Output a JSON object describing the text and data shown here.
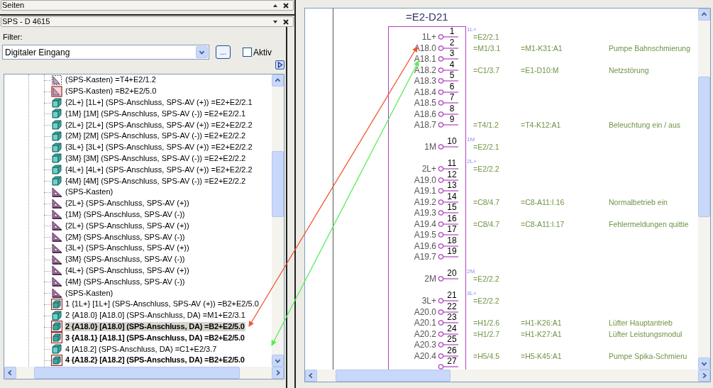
{
  "pages_panel": {
    "title": "Seiten"
  },
  "plc_panel": {
    "title": "SPS - D 4615",
    "filter_label": "Filter:",
    "filter": {
      "value": "Digitaler Eingang"
    },
    "browse_button": "...",
    "active_checkbox": {
      "label": "Aktiv",
      "checked": false
    },
    "tree": {
      "items": [
        {
          "kind": "box_dashed",
          "label": "(SPS-Kasten) =T4+E2/1.2",
          "bold": false,
          "selected": false
        },
        {
          "kind": "box_framed",
          "label": "(SPS-Kasten) =B2+E2/5.0",
          "bold": false,
          "selected": false
        },
        {
          "kind": "cube",
          "label": "{2L+} [1L+] (SPS-Anschluss, SPS-AV (+)) =E2+E2/2.1",
          "bold": false,
          "selected": false
        },
        {
          "kind": "cube",
          "label": "{1M} [1M] (SPS-Anschluss, SPS-AV (-)) =E2+E2/2.1",
          "bold": false,
          "selected": false
        },
        {
          "kind": "cube",
          "label": "{2L+} [2L+] (SPS-Anschluss, SPS-AV (+)) =E2+E2/2.2",
          "bold": false,
          "selected": false
        },
        {
          "kind": "cube",
          "label": "{2M} [2M] (SPS-Anschluss, SPS-AV (-)) =E2+E2/2.2",
          "bold": false,
          "selected": false
        },
        {
          "kind": "cube",
          "label": "{3L+} [3L+] (SPS-Anschluss, SPS-AV (+)) =E2+E2/2.2",
          "bold": false,
          "selected": false
        },
        {
          "kind": "cube",
          "label": "{3M} [3M] (SPS-Anschluss, SPS-AV (-)) =E2+E2/2.2",
          "bold": false,
          "selected": false
        },
        {
          "kind": "cube",
          "label": "{4L+} [4L+] (SPS-Anschluss, SPS-AV (+)) =E2+E2/2.2",
          "bold": false,
          "selected": false
        },
        {
          "kind": "cube",
          "label": "{4M} [4M] (SPS-Anschluss, SPS-AV (-)) =E2+E2/2.2",
          "bold": false,
          "selected": false
        },
        {
          "kind": "triangle",
          "label": "(SPS-Kasten)",
          "bold": false,
          "selected": false
        },
        {
          "kind": "triangle",
          "label": "{2L+} (SPS-Anschluss, SPS-AV (+))",
          "bold": false,
          "selected": false
        },
        {
          "kind": "triangle",
          "label": "{1M} (SPS-Anschluss, SPS-AV (-))",
          "bold": false,
          "selected": false
        },
        {
          "kind": "triangle",
          "label": "{2L+} (SPS-Anschluss, SPS-AV (+))",
          "bold": false,
          "selected": false
        },
        {
          "kind": "triangle",
          "label": "{2M} (SPS-Anschluss, SPS-AV (-))",
          "bold": false,
          "selected": false
        },
        {
          "kind": "triangle",
          "label": "{3L+} (SPS-Anschluss, SPS-AV (+))",
          "bold": false,
          "selected": false
        },
        {
          "kind": "triangle",
          "label": "{3M} (SPS-Anschluss, SPS-AV (-))",
          "bold": false,
          "selected": false
        },
        {
          "kind": "triangle",
          "label": "{4L+} (SPS-Anschluss, SPS-AV (+))",
          "bold": false,
          "selected": false
        },
        {
          "kind": "triangle",
          "label": "{4M} (SPS-Anschluss, SPS-AV (-))",
          "bold": false,
          "selected": false
        },
        {
          "kind": "triangle",
          "label": "(SPS-Kasten)",
          "bold": false,
          "selected": false
        },
        {
          "kind": "cube_framed",
          "label": "1 {1L+} [1L+] (SPS-Anschluss, SPS-AV (+)) =B2+E2/5.0",
          "bold": false,
          "selected": false
        },
        {
          "kind": "cube",
          "label": "2 {A18.0} [A18.0] (SPS-Anschluss, DA) =M1+E2/3.1",
          "bold": false,
          "selected": false
        },
        {
          "kind": "cube_framed",
          "label": "2 {A18.0} [A18.0] (SPS-Anschluss, DA) =B2+E2/5.0",
          "bold": true,
          "selected": true
        },
        {
          "kind": "cube_framed",
          "label": "3 {A18.1} [A18.1] (SPS-Anschluss, DA) =B2+E2/5.0",
          "bold": true,
          "selected": false
        },
        {
          "kind": "cube",
          "label": "4  [A18.2] (SPS-Anschluss, DA) =C1+E2/3.7",
          "bold": false,
          "selected": false
        },
        {
          "kind": "cube_framed",
          "label": "4 {A18.2} [A18.2] (SPS-Anschluss, DA) =B2+E2/5.0",
          "bold": true,
          "selected": false
        }
      ]
    }
  },
  "schematic": {
    "title": "=E2-D21",
    "groups": [
      {
        "pins": [
          {
            "number": "1",
            "label": "1L+",
            "potential": "1L+",
            "page_ref": "=E2/2.1"
          },
          {
            "number": "2",
            "label": "A18.0",
            "page_ref": "=M1/3.1",
            "device_ref": "=M1-K31:A1",
            "description": "Pumpe Bahnschmierung"
          },
          {
            "number": "3",
            "label": "A18.1"
          },
          {
            "number": "4",
            "label": "A18.2",
            "page_ref": "=C1/3.7",
            "device_ref": "=E1-D10:M",
            "description": "Netzstörung"
          },
          {
            "number": "5",
            "label": "A18.3"
          },
          {
            "number": "6",
            "label": "A18.4"
          },
          {
            "number": "7",
            "label": "A18.5"
          },
          {
            "number": "8",
            "label": "A18.6"
          },
          {
            "number": "9",
            "label": "A18.7",
            "page_ref": "=T4/1.2",
            "device_ref": "=T4-K12:A1",
            "description": "Beleuchtung ein / aus"
          }
        ]
      },
      {
        "pins": [
          {
            "number": "10",
            "label": "1M",
            "potential": "1M",
            "page_ref": "=E2/2.1"
          }
        ]
      },
      {
        "pins": [
          {
            "number": "11",
            "label": "2L+",
            "potential": "2L+",
            "page_ref": "=E2/2.2"
          },
          {
            "number": "12",
            "label": "A19.0"
          },
          {
            "number": "13",
            "label": "A19.1"
          },
          {
            "number": "14",
            "label": "A19.2",
            "page_ref": "=C8/4.7",
            "device_ref": "=C8-A11:I.16",
            "description": "Normalbetrieb ein"
          },
          {
            "number": "15",
            "label": "A19.3"
          },
          {
            "number": "16",
            "label": "A19.4",
            "page_ref": "=C8/4.7",
            "device_ref": "=C8-A11:I.17",
            "description": "Fehlermeldungen quittie"
          },
          {
            "number": "17",
            "label": "A19.5"
          },
          {
            "number": "18",
            "label": "A19.6"
          },
          {
            "number": "19",
            "label": "A19.7"
          }
        ]
      },
      {
        "pins": [
          {
            "number": "20",
            "label": "2M",
            "potential": "2M",
            "page_ref": "=E2/2.2"
          }
        ]
      },
      {
        "pins": [
          {
            "number": "21",
            "label": "3L+",
            "potential": "3L+",
            "page_ref": "=E2/2.2"
          },
          {
            "number": "22",
            "label": "A20.0"
          },
          {
            "number": "23",
            "label": "A20.1",
            "page_ref": "=H1/2.6",
            "device_ref": "=H1-K26:A1",
            "description": "Lüfter Hauptantrieb"
          },
          {
            "number": "24",
            "label": "A20.2",
            "page_ref": "=H1/2.7",
            "device_ref": "=H1-K27:A1",
            "description": "Lüfter Leistungsmodul"
          },
          {
            "number": "25",
            "label": "A20.3"
          },
          {
            "number": "26",
            "label": "A20.4",
            "page_ref": "=H5/4.5",
            "device_ref": "=H5-K45:A1",
            "description": "Pumpe Spika-Schmieru"
          },
          {
            "number": "27"
          }
        ]
      }
    ]
  }
}
